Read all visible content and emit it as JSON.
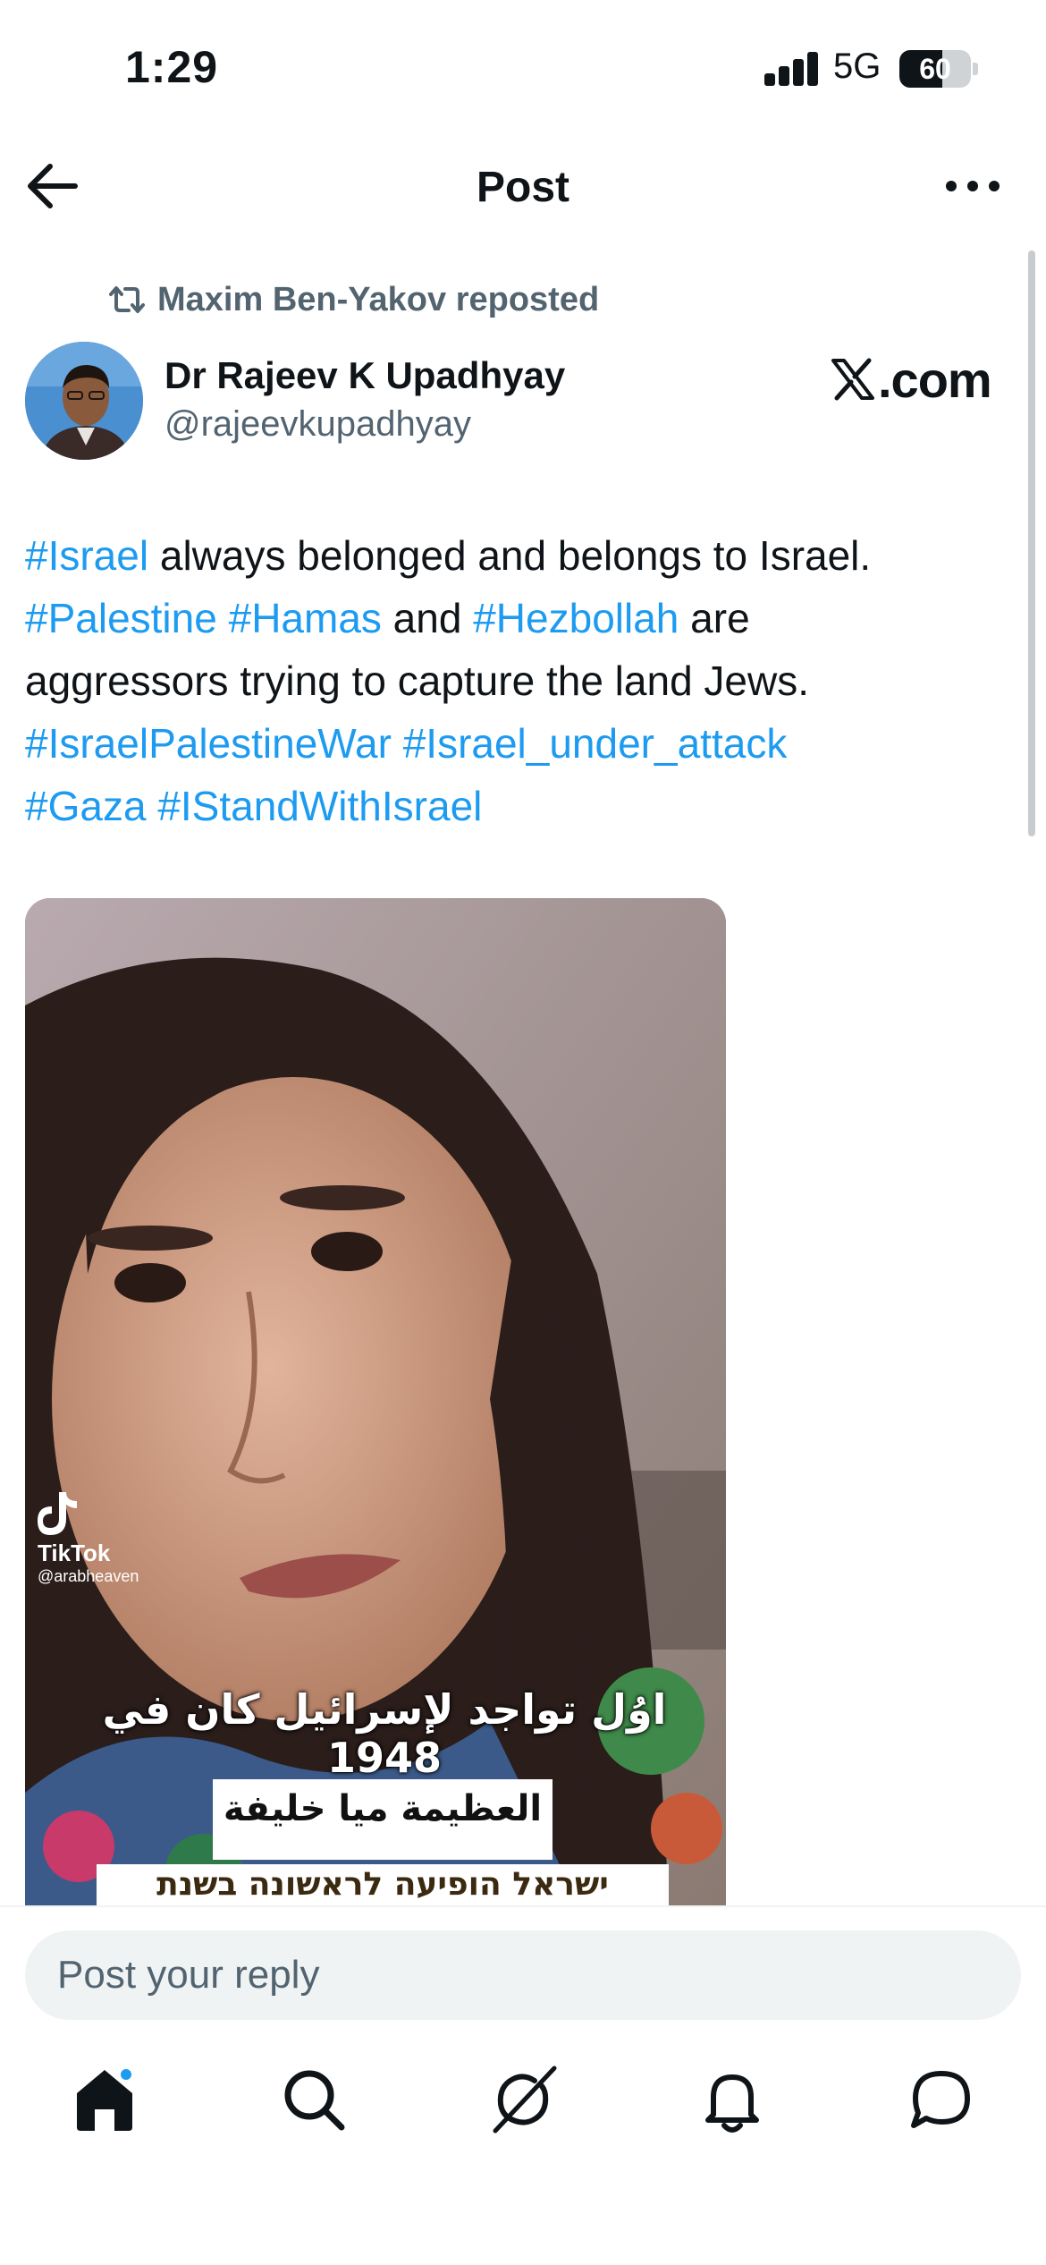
{
  "status_bar": {
    "time": "1:29",
    "network": "5G",
    "battery": "60",
    "battery_level_percent": 60
  },
  "header": {
    "title": "Post",
    "back_icon": "arrow-left-icon",
    "more_icon": "more-horizontal-icon"
  },
  "post": {
    "repost_label": "Maxim Ben-Yakov reposted",
    "author": {
      "name": "Dr Rajeev K Upadhyay",
      "handle": "@rajeevkupadhyay"
    },
    "source_label": ".com",
    "text_lines": [
      [
        {
          "text": "#Israel",
          "hashtag": true
        },
        {
          "text": " always belonged and belongs to Israel.",
          "hashtag": false
        }
      ],
      [
        {
          "text": "#Palestine",
          "hashtag": true
        },
        {
          "text": " ",
          "hashtag": false
        },
        {
          "text": "#Hamas",
          "hashtag": true
        },
        {
          "text": " and ",
          "hashtag": false
        },
        {
          "text": "#Hezbollah",
          "hashtag": true
        },
        {
          "text": " are",
          "hashtag": false
        }
      ],
      [
        {
          "text": "aggressors trying to capture the land Jews.",
          "hashtag": false
        }
      ],
      [
        {
          "text": "#IsraelPalestineWar",
          "hashtag": true
        },
        {
          "text": " ",
          "hashtag": false
        },
        {
          "text": "#Israel_under_attack",
          "hashtag": true
        }
      ],
      [
        {
          "text": "#Gaza",
          "hashtag": true
        },
        {
          "text": " ",
          "hashtag": false
        },
        {
          "text": "#IStandWithIsrael",
          "hashtag": true
        }
      ]
    ],
    "media": {
      "watermark_app": "TikTok",
      "watermark_user": "@arabheaven",
      "caption_arabic_line1": "اوُل تواجد لإسرائيل كان في 1948",
      "caption_arabic_line2": "العظيمة ميا خليفة",
      "caption_hebrew": "ישראל הופיעה לראשונה בשנת"
    }
  },
  "reply": {
    "placeholder": "Post your reply"
  },
  "tab_bar": {
    "items": [
      "home-icon",
      "search-icon",
      "grok-icon",
      "notifications-bell-icon",
      "messages-icon"
    ],
    "home_has_badge": true
  },
  "colors": {
    "link": "#1d9bf0",
    "text_primary": "#0f1419",
    "text_secondary": "#536471"
  }
}
